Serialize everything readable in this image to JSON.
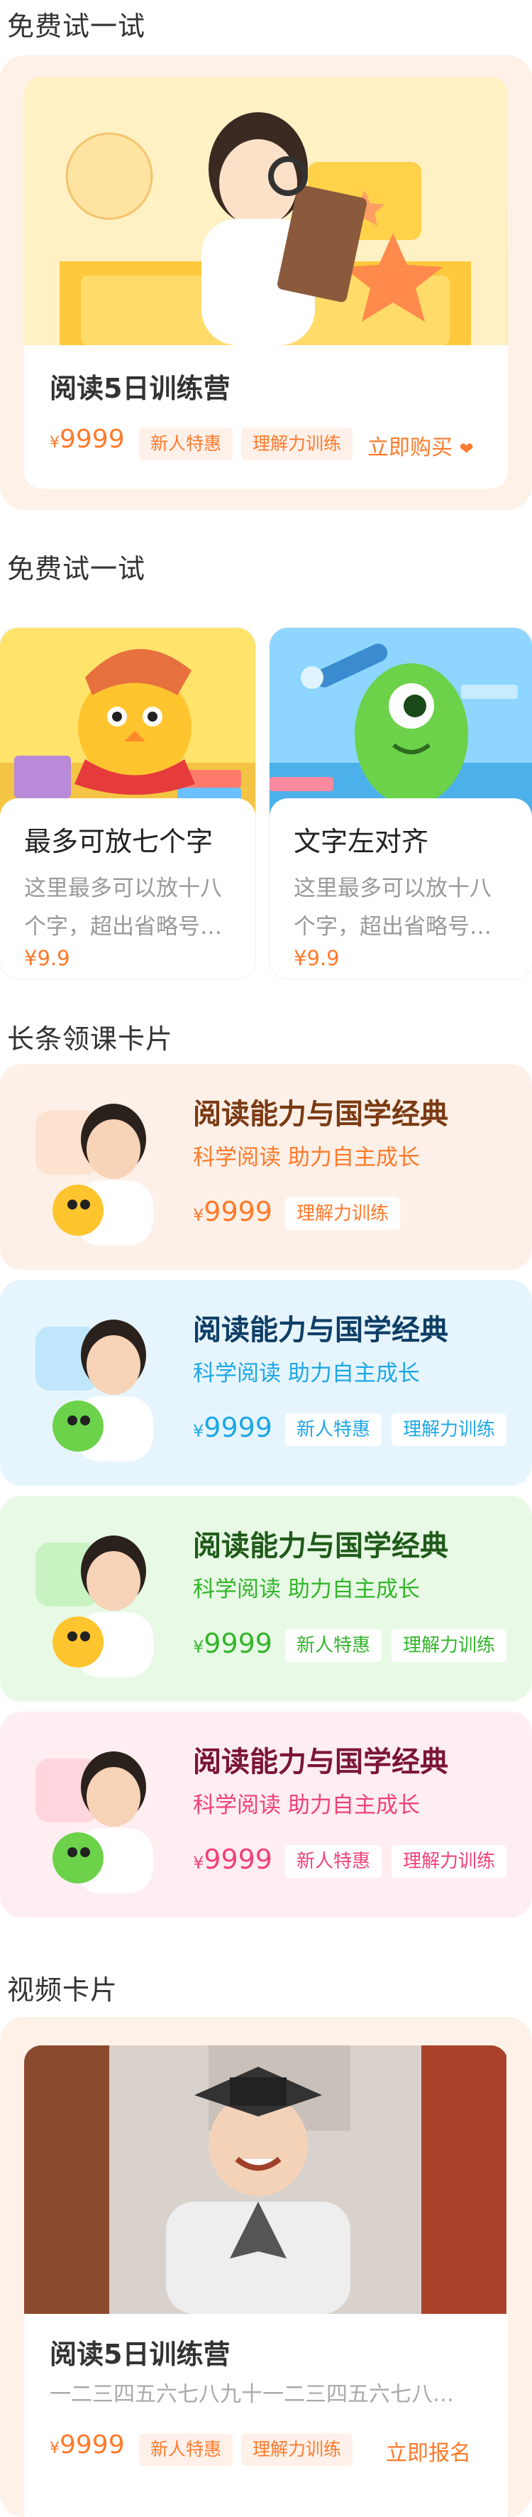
{
  "section1": {
    "title": "免费试一试"
  },
  "card1": {
    "title": "阅读5日训练营",
    "price": "9999",
    "currency": "¥",
    "tags": [
      "新人特惠",
      "理解力训练"
    ],
    "action": "立即购买",
    "action_icon": "heart-icon"
  },
  "section2": {
    "title": "免费试一试"
  },
  "small_cards": [
    {
      "title": "最多可放七个字",
      "desc": "这里最多可以放十八个字，超出省略号…",
      "price": "¥9.9"
    },
    {
      "title": "文字左对齐",
      "desc": "这里最多可以放十八个字，超出省略号…",
      "price": "¥9.9"
    }
  ],
  "section3": {
    "title": "长条领课卡片"
  },
  "long_cards": [
    {
      "title": "阅读能力与国学经典",
      "subtitle": "科学阅读 助力自主成长",
      "currency": "¥",
      "price": "9999",
      "tags": [
        "理解力训练"
      ],
      "bg": "#fdf0e8",
      "title_color": "#7a3a12",
      "accent": "#ff7a2a"
    },
    {
      "title": "阅读能力与国学经典",
      "subtitle": "科学阅读 助力自主成长",
      "currency": "¥",
      "price": "9999",
      "tags": [
        "新人特惠",
        "理解力训练"
      ],
      "bg": "#e6f5fd",
      "title_color": "#0e3e66",
      "accent": "#1ea7e6"
    },
    {
      "title": "阅读能力与国学经典",
      "subtitle": "科学阅读 助力自主成长",
      "currency": "¥",
      "price": "9999",
      "tags": [
        "新人特惠",
        "理解力训练"
      ],
      "bg": "#e8fae6",
      "title_color": "#1f5a19",
      "accent": "#34b52b"
    },
    {
      "title": "阅读能力与国学经典",
      "subtitle": "科学阅读 助力自主成长",
      "currency": "¥",
      "price": "9999",
      "tags": [
        "新人特惠",
        "理解力训练"
      ],
      "bg": "#ffeef1",
      "title_color": "#7a1536",
      "accent": "#f0427a"
    }
  ],
  "section4": {
    "title": "视频卡片"
  },
  "card2": {
    "title": "阅读5日训练营",
    "desc": "一二三四五六七八九十一二三四五六七八…",
    "currency": "¥",
    "price": "9999",
    "tags": [
      "新人特惠",
      "理解力训练"
    ],
    "action": "立即报名"
  },
  "colors": {
    "accent": "#ff7a2a",
    "card_bg": "#fdf1e8"
  }
}
